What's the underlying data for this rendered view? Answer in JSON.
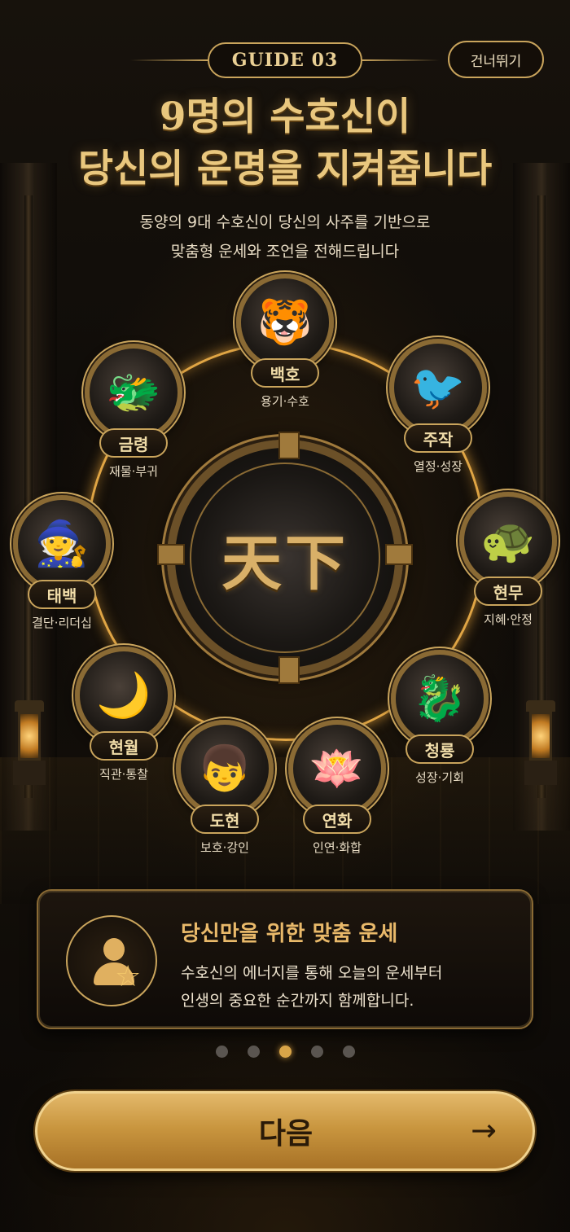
{
  "header": {
    "guide_label": "GUIDE 03",
    "skip_label": "건너뛰기"
  },
  "title": {
    "line1": "9명의 수호신이",
    "line2": "당신의 운명을 지켜줍니다"
  },
  "subtitle": {
    "line1": "동양의 9대 수호신이 당신의 사주를 기반으로",
    "line2": "맞춤형 운세와 조언을 전해드립니다"
  },
  "center": {
    "text": "天下"
  },
  "guardians": [
    {
      "name": "백호",
      "traits": "용기·수호",
      "icon": "tiger-icon"
    },
    {
      "name": "주작",
      "traits": "열정·성장",
      "icon": "phoenix-icon"
    },
    {
      "name": "현무",
      "traits": "지혜·안정",
      "icon": "turtle-snake-icon"
    },
    {
      "name": "청룡",
      "traits": "성장·기회",
      "icon": "azure-dragon-icon"
    },
    {
      "name": "연화",
      "traits": "인연·화합",
      "icon": "lotus-icon"
    },
    {
      "name": "도현",
      "traits": "보호·강인",
      "icon": "child-warrior-icon"
    },
    {
      "name": "현월",
      "traits": "직관·통찰",
      "icon": "moon-maiden-icon"
    },
    {
      "name": "태백",
      "traits": "결단·리더십",
      "icon": "sage-icon"
    },
    {
      "name": "금령",
      "traits": "재물·부귀",
      "icon": "golden-dragon-icon"
    }
  ],
  "card": {
    "title": "당신만을 위한 맞춤 운세",
    "desc_line1": "수호신의 에너지를 통해 오늘의 운세부터",
    "desc_line2": "인생의 중요한 순간까지 함께합니다.",
    "icon": "person-star-icon"
  },
  "pager": {
    "total": 5,
    "active_index": 2
  },
  "next_button": {
    "label": "다음",
    "icon": "arrow-right-icon"
  },
  "colors": {
    "gold": "#c9a45c",
    "title_gold": "#e9c77e",
    "accent_orange": "#e9b96a",
    "active_dot": "#d9a548",
    "inactive_dot": "#5a5550"
  }
}
